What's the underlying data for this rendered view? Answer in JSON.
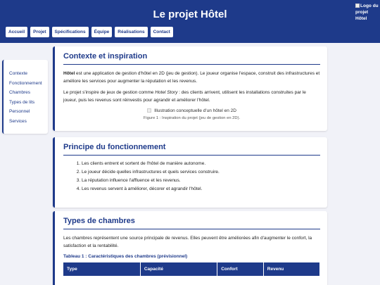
{
  "header": {
    "title": "Le projet Hôtel",
    "logo_alt": "Logo du projet Hôtel",
    "nav": [
      "Accueil",
      "Projet",
      "Spécifications",
      "Équipe",
      "Réalisations",
      "Contact"
    ]
  },
  "sidebar": {
    "items": [
      "Contexte",
      "Fonctionnement",
      "Chambres",
      "Types de lits",
      "Personnel",
      "Services"
    ]
  },
  "context": {
    "title": "Contexte et inspiration",
    "p1_strong": "Hôtel",
    "p1_rest": " est une application de gestion d'hôtel en 2D (jeu de gestion). Le joueur organise l'espace, construit des infrastructures et améliore les services pour augmenter la réputation et les revenus.",
    "p2_before": "Le projet s'inspire de jeux de gestion comme ",
    "p2_em": "Hotel Story",
    "p2_after": " : des clients arrivent, utilisent les installations construites par le joueur, puis les revenus sont réinvestis pour agrandir et améliorer l'hôtel.",
    "figure_alt": "Illustration conceptuelle d'un hôtel en 2D",
    "figure_caption": "Figure 1 : Inspiration du projet (jeu de gestion en 2D)."
  },
  "principle": {
    "title": "Principe du fonctionnement",
    "steps": [
      "Les clients entrent et sortent de l'hôtel de manière autonome.",
      "Le joueur décide quelles infrastructures et quels services construire.",
      "La réputation influence l'affluence et les revenus.",
      "Les revenus servent à améliorer, décorer et agrandir l'hôtel."
    ]
  },
  "rooms": {
    "title": "Types de chambres",
    "intro": "Les chambres représentent une source principale de revenus. Elles peuvent être améliorées afin d'augmenter le confort, la satisfaction et la rentabilité.",
    "table_caption": "Tableau 1 : Caractéristiques des chambres (prévisionnel)",
    "headers": [
      "Type",
      "Capacité",
      "Confort",
      "Revenu"
    ]
  }
}
